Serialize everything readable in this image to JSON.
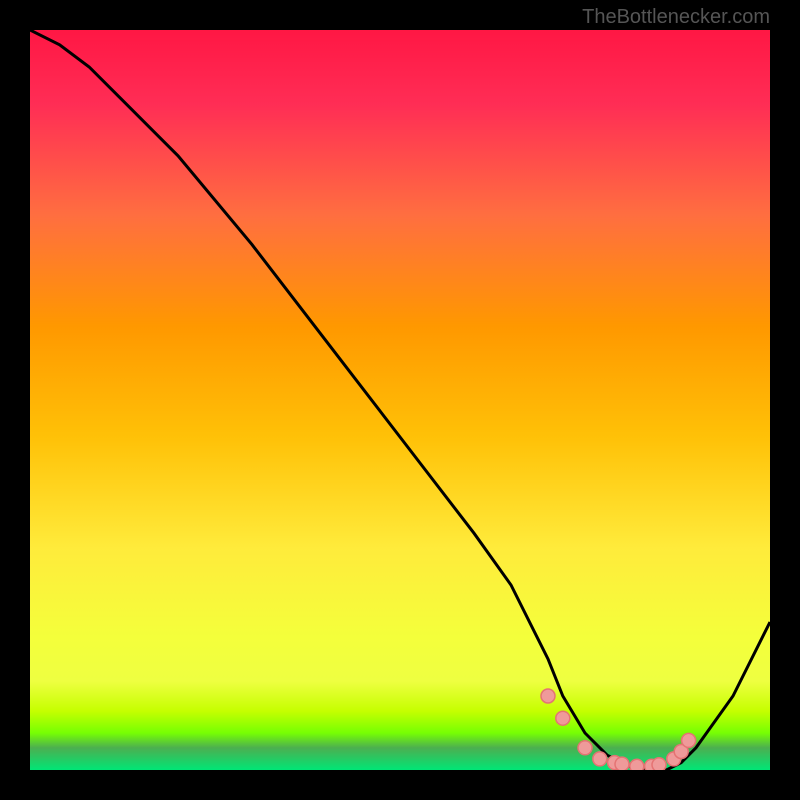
{
  "attribution": "TheBottlenecker.com",
  "chart_data": {
    "type": "line",
    "title": "",
    "xlabel": "",
    "ylabel": "",
    "xlim": [
      0,
      100
    ],
    "ylim": [
      0,
      100
    ],
    "background": {
      "type": "vertical-gradient",
      "stops": [
        {
          "pos": 0,
          "color": "#ff1744"
        },
        {
          "pos": 0.25,
          "color": "#ff6e40"
        },
        {
          "pos": 0.5,
          "color": "#ffc107"
        },
        {
          "pos": 0.72,
          "color": "#ffeb3b"
        },
        {
          "pos": 0.85,
          "color": "#eeff41"
        },
        {
          "pos": 0.92,
          "color": "#c6ff00"
        },
        {
          "pos": 0.96,
          "color": "#76ff03"
        },
        {
          "pos": 1.0,
          "color": "#00e676"
        }
      ]
    },
    "series": [
      {
        "name": "bottleneck-curve",
        "color": "#000000",
        "x": [
          0,
          4,
          8,
          12,
          16,
          20,
          30,
          40,
          50,
          60,
          65,
          70,
          72,
          75,
          78,
          80,
          82,
          84,
          86,
          88,
          90,
          95,
          100
        ],
        "y": [
          100,
          98,
          95,
          91,
          87,
          83,
          71,
          58,
          45,
          32,
          25,
          15,
          10,
          5,
          2,
          1,
          0,
          0,
          0,
          1,
          3,
          10,
          20
        ]
      }
    ],
    "markers": {
      "name": "data-points",
      "color": "#ef9a9a",
      "stroke": "#e57373",
      "x": [
        70,
        72,
        75,
        77,
        79,
        80,
        82,
        84,
        85,
        87,
        88,
        89
      ],
      "y": [
        10,
        7,
        3,
        1.5,
        1,
        0.8,
        0.5,
        0.5,
        0.7,
        1.5,
        2.5,
        4
      ]
    }
  }
}
